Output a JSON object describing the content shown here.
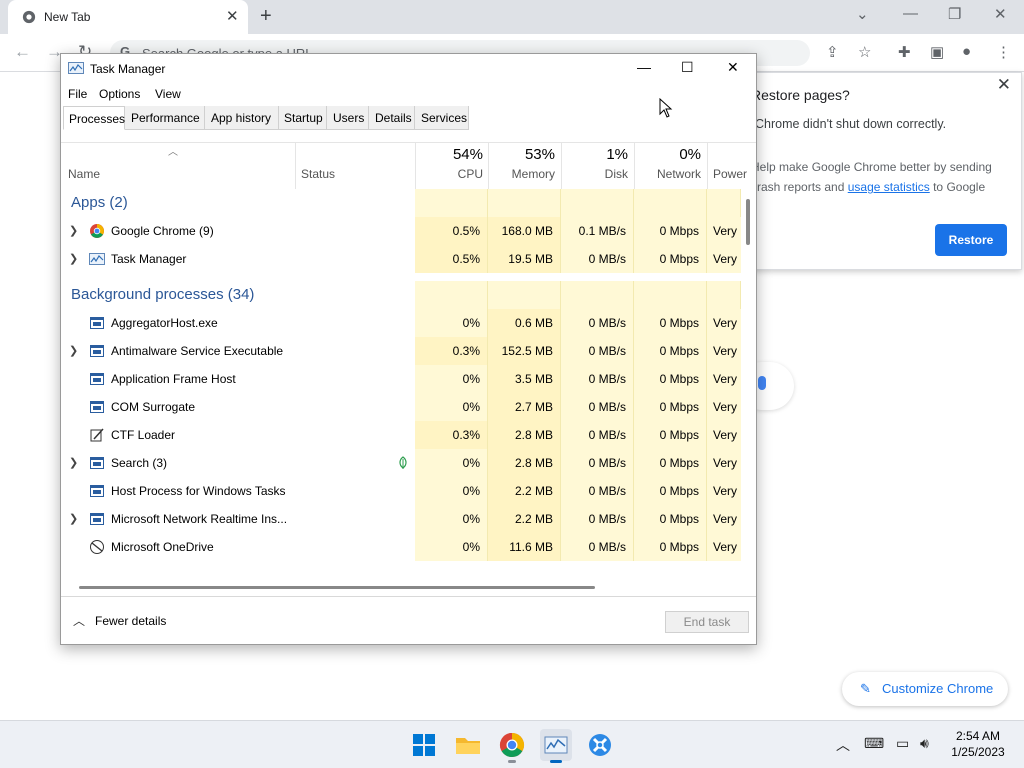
{
  "chrome": {
    "tab_title": "New Tab",
    "omnibox_placeholder": "Search Google or type a URL",
    "restore_popup": {
      "title": "Restore pages?",
      "body": "Chrome didn't shut down correctly.",
      "consent_before": "Help make Google Chrome better by sending crash reports and ",
      "consent_link": "usage statistics",
      "consent_after": " to Google",
      "button": "Restore"
    },
    "customize_label": "Customize Chrome"
  },
  "task_manager": {
    "title": "Task Manager",
    "menu": [
      "File",
      "Options",
      "View"
    ],
    "tabs": [
      "Processes",
      "Performance",
      "App history",
      "Startup",
      "Users",
      "Details",
      "Services"
    ],
    "active_tab": "Processes",
    "columns": {
      "name": "Name",
      "status": "Status",
      "cpu_pct": "54%",
      "cpu": "CPU",
      "memory_pct": "53%",
      "memory": "Memory",
      "disk_pct": "1%",
      "disk": "Disk",
      "network_pct": "0%",
      "network": "Network",
      "power": "Power u"
    },
    "groups": {
      "apps": "Apps (2)",
      "background": "Background processes (34)"
    },
    "apps": [
      {
        "name": "Google Chrome (9)",
        "cpu": "0.5%",
        "memory": "168.0 MB",
        "disk": "0.1 MB/s",
        "network": "0 Mbps",
        "power": "Very",
        "expandable": true,
        "icon": "chrome-icon"
      },
      {
        "name": "Task Manager",
        "cpu": "0.5%",
        "memory": "19.5 MB",
        "disk": "0 MB/s",
        "network": "0 Mbps",
        "power": "Very",
        "expandable": true,
        "icon": "task-manager-icon"
      }
    ],
    "background": [
      {
        "name": "AggregatorHost.exe",
        "cpu": "0%",
        "memory": "0.6 MB",
        "disk": "0 MB/s",
        "network": "0 Mbps",
        "power": "Very",
        "expandable": false,
        "icon": "process-icon"
      },
      {
        "name": "Antimalware Service Executable",
        "cpu": "0.3%",
        "memory": "152.5 MB",
        "disk": "0 MB/s",
        "network": "0 Mbps",
        "power": "Very",
        "expandable": true,
        "icon": "process-icon"
      },
      {
        "name": "Application Frame Host",
        "cpu": "0%",
        "memory": "3.5 MB",
        "disk": "0 MB/s",
        "network": "0 Mbps",
        "power": "Very",
        "expandable": false,
        "icon": "process-icon"
      },
      {
        "name": "COM Surrogate",
        "cpu": "0%",
        "memory": "2.7 MB",
        "disk": "0 MB/s",
        "network": "0 Mbps",
        "power": "Very",
        "expandable": false,
        "icon": "process-icon"
      },
      {
        "name": "CTF Loader",
        "cpu": "0.3%",
        "memory": "2.8 MB",
        "disk": "0 MB/s",
        "network": "0 Mbps",
        "power": "Very",
        "expandable": false,
        "icon": "ctf-loader-icon"
      },
      {
        "name": "Search (3)",
        "cpu": "0%",
        "memory": "2.8 MB",
        "disk": "0 MB/s",
        "network": "0 Mbps",
        "power": "Very",
        "expandable": true,
        "icon": "process-icon",
        "status_icon": "leaf-icon"
      },
      {
        "name": "Host Process for Windows Tasks",
        "cpu": "0%",
        "memory": "2.2 MB",
        "disk": "0 MB/s",
        "network": "0 Mbps",
        "power": "Very",
        "expandable": false,
        "icon": "process-icon"
      },
      {
        "name": "Microsoft Network Realtime Ins...",
        "cpu": "0%",
        "memory": "2.2 MB",
        "disk": "0 MB/s",
        "network": "0 Mbps",
        "power": "Very",
        "expandable": true,
        "icon": "process-icon"
      },
      {
        "name": "Microsoft OneDrive",
        "cpu": "0%",
        "memory": "11.6 MB",
        "disk": "0 MB/s",
        "network": "0 Mbps",
        "power": "Very",
        "expandable": false,
        "icon": "onedrive-icon"
      }
    ],
    "footer": {
      "fewer_details": "Fewer details",
      "end_task": "End task"
    },
    "colors": {
      "cell_light": "#fff9d6",
      "cell_mid": "#fff4c4",
      "group_text": "#2b5797"
    }
  },
  "taskbar": {
    "apps": [
      "start-icon",
      "file-explorer-icon",
      "chrome-icon",
      "task-manager-icon",
      "settings-app-icon"
    ],
    "active_app": "task-manager-icon",
    "clock_time": "2:54 AM",
    "clock_date": "1/25/2023"
  }
}
